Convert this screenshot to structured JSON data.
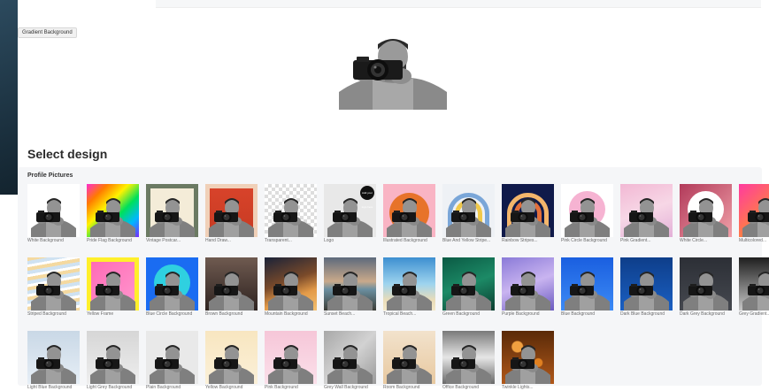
{
  "tooltip": "Gradient Background",
  "section_title": "Select design",
  "category": "Profile Pictures",
  "colors": {
    "panel_bg": "#f5f6f8",
    "title": "#2b2b2b"
  },
  "logo_badge": "Add your logo here",
  "designs": [
    {
      "label": "White Background",
      "bg": "#ffffff"
    },
    {
      "label": "Pride Flag Background",
      "bg": "linear-gradient(135deg,#ff2bd0,#ff7b00,#fff200,#00e05a,#00b7ff,#7a2bff)"
    },
    {
      "label": "Vintage Postcar...",
      "bg": "linear-gradient(#f4ecd8,#f4ecd8)",
      "frame": "#6b7a63"
    },
    {
      "label": "Hand Draw...",
      "bg": "linear-gradient(#d9442b,#c73a22)",
      "frame": "#f0d0b8"
    },
    {
      "label": "Transparent...",
      "bg": "repeating-conic-gradient(#dddddd 0% 25%, #ffffff 0% 50%) 0 0/8px 8px"
    },
    {
      "label": "Logo",
      "bg": "#e8e8e8",
      "logo": true
    },
    {
      "label": "Illustrated Background",
      "bg": "linear-gradient(#f9b4c4,#f9b4c4)",
      "sun": "#e7732a"
    },
    {
      "label": "Blue And Yellow Stripe...",
      "bg": "#eef1f5",
      "arch": [
        "#7aa6d8",
        "#f1c94a",
        "#ffffff"
      ]
    },
    {
      "label": "Rainbow Stripes...",
      "bg": "#101a4a",
      "arch": [
        "#f4b66b",
        "#e4703a",
        "#b2c6e8"
      ]
    },
    {
      "label": "Pink Circle Background",
      "bg": "#ffffff",
      "circle": "#f6b3d2"
    },
    {
      "label": "Pink Gradient...",
      "bg": "linear-gradient(160deg,#f2b8d4,#f7d7e6,#e3b0d8)"
    },
    {
      "label": "White Circle...",
      "bg": "linear-gradient(135deg,#b23a5a,#f0a0a8)",
      "circle": "#ffffff"
    },
    {
      "label": "Multicolored...",
      "bg": "linear-gradient(135deg,#ff3aa0,#ff7a4a,#ffb03a)"
    },
    {
      "label": "Striped Background",
      "bg": "repeating-linear-gradient(170deg,#f4d9a0 0 4px,#cfe2f2 4px 8px,#ffffff 8px 11px)"
    },
    {
      "label": "Yellow Frame",
      "bg": "linear-gradient(135deg,#ff66b3,#ff9ad0)",
      "frame": "#ffef2b"
    },
    {
      "label": "Blue Circle Background",
      "bg": "#1a6cf2",
      "circle": "#2fd0e0"
    },
    {
      "label": "Brown Background",
      "bg": "linear-gradient(#6f5a50,#2e2320)"
    },
    {
      "label": "Mountain Background",
      "bg": "linear-gradient(160deg,#1a2238 0%,#7a4a2a 45%,#e39a48 70%,#f2c070 100%)"
    },
    {
      "label": "Sunset Beach...",
      "bg": "linear-gradient(#5d6a7c 0%,#c9a98a 45%,#6b8fa0 60%,#3c3c36 100%)"
    },
    {
      "label": "Tropical Beach...",
      "bg": "linear-gradient(#3d8fd0 0%,#9ed4ee 50%,#e9dcb8 80%,#f2e7c9 100%)"
    },
    {
      "label": "Green Background",
      "bg": "linear-gradient(160deg,#0b5a44,#1c8a66,#0a3d2f)"
    },
    {
      "label": "Purple Background",
      "bg": "linear-gradient(160deg,#8a7ad8,#c9b4f0,#6a5ac0)"
    },
    {
      "label": "Blue Background",
      "bg": "linear-gradient(#1a5fe0,#3c8af5)"
    },
    {
      "label": "Dark Blue Background",
      "bg": "linear-gradient(#0e3e8a,#1a5fc2)"
    },
    {
      "label": "Dark Grey Background",
      "bg": "linear-gradient(#2c2f36,#45484f)"
    },
    {
      "label": "Grey Gradient...",
      "bg": "linear-gradient(#1e1e1e,#c8c8c8)"
    },
    {
      "label": "Light Blue Background",
      "bg": "linear-gradient(#c9d8e6,#e6eef6)"
    },
    {
      "label": "Light Grey Background",
      "bg": "linear-gradient(#d6d6d6,#eeeeee)"
    },
    {
      "label": "Plain Background",
      "bg": "#e9e9e9"
    },
    {
      "label": "Yellow Background",
      "bg": "linear-gradient(#f8e6c0,#fbf0d8)"
    },
    {
      "label": "Pink Background",
      "bg": "linear-gradient(#f6c6d8,#fbe0ea)"
    },
    {
      "label": "Grey Wall Background",
      "bg": "linear-gradient(135deg,#a8a8a8,#d2d2d2,#9a9a9a)"
    },
    {
      "label": "Room Background",
      "bg": "linear-gradient(#f2e2cc,#e8c9a0)"
    },
    {
      "label": "Office Background",
      "bg": "linear-gradient(#7a7a7a,#e6e6e6,#6a6a6a)"
    },
    {
      "label": "Twinkle Lights...",
      "bg": "radial-gradient(circle at 30% 30%,#f0a040 0 10%,transparent 12%), radial-gradient(circle at 70% 60%,#e08020 0 8%,transparent 10%), linear-gradient(#5a2a08,#b0581a)"
    }
  ]
}
